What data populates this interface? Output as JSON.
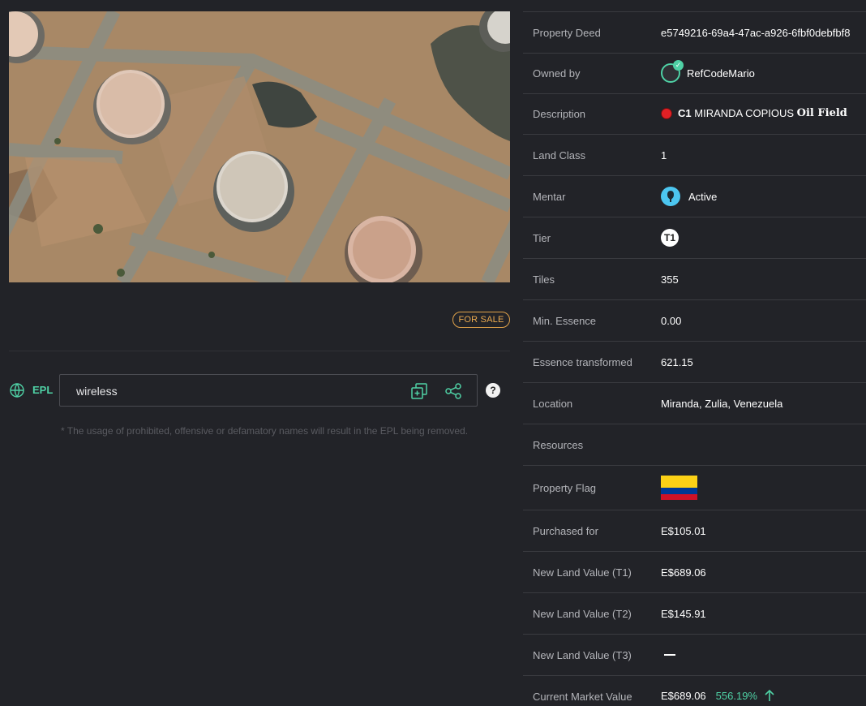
{
  "listing": {
    "status_badge": "FOR SALE"
  },
  "epl": {
    "label": "EPL",
    "value": "wireless",
    "note": "* The usage of prohibited, offensive or defamatory names will result in the EPL being removed.",
    "help_symbol": "?"
  },
  "details": {
    "deed_label": "Property Deed",
    "deed_value": "e5749216-69a4-47ac-a926-6fbf0debfbf8",
    "owner_label": "Owned by",
    "owner_value": "RefCodeMario",
    "description_label": "Description",
    "description_prefix": "C1",
    "description_name": "MIRANDA COPIOUS",
    "description_type": "Oil Field",
    "land_class_label": "Land Class",
    "land_class_value": "1",
    "mentar_label": "Mentar",
    "mentar_value": "Active",
    "tier_label": "Tier",
    "tier_value": "T1",
    "tiles_label": "Tiles",
    "tiles_value": "355",
    "min_essence_label": "Min. Essence",
    "min_essence_value": "0.00",
    "essence_transformed_label": "Essence transformed",
    "essence_transformed_value": "621.15",
    "location_label": "Location",
    "location_value": "Miranda, Zulia, Venezuela",
    "resources_label": "Resources",
    "flag_label": "Property Flag",
    "purchased_label": "Purchased for",
    "purchased_value": "E$105.01",
    "nlv_t1_label": "New Land Value (T1)",
    "nlv_t1_value": "E$689.06",
    "nlv_t2_label": "New Land Value (T2)",
    "nlv_t2_value": "E$145.91",
    "nlv_t3_label": "New Land Value (T3)",
    "cmv_label": "Current Market Value",
    "cmv_value": "E$689.06",
    "cmv_change": "556.19%"
  },
  "colors": {
    "accent_green": "#4fd1a5",
    "sale_orange": "#e9a94f",
    "background": "#222328"
  }
}
